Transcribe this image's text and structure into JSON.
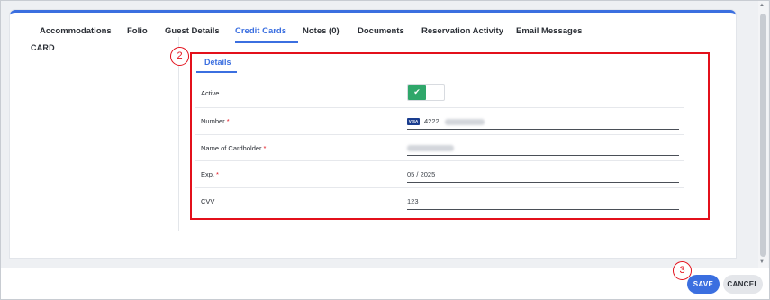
{
  "tabs": [
    {
      "label": "Accommodations"
    },
    {
      "label": "Folio"
    },
    {
      "label": "Guest Details"
    },
    {
      "label": "Credit Cards"
    },
    {
      "label": "Notes (0)"
    },
    {
      "label": "Documents"
    },
    {
      "label": "Reservation Activity"
    },
    {
      "label": "Email Messages"
    }
  ],
  "active_tab": "Credit Cards",
  "sidebar": {
    "label": "CARD"
  },
  "badges": {
    "two": "2",
    "three": "3"
  },
  "details": {
    "tab_label": "Details",
    "fields": {
      "active": {
        "label": "Active",
        "state": true
      },
      "number": {
        "label": "Number",
        "required": "*",
        "card_brand": "VISA",
        "value": "4222"
      },
      "cardholder": {
        "label": "Name of Cardholder",
        "required": "*"
      },
      "exp": {
        "label": "Exp.",
        "required": "*",
        "value": "05 / 2025"
      },
      "cvv": {
        "label": "CVV",
        "value": "123"
      }
    }
  },
  "footer": {
    "save_label": "SAVE",
    "cancel_label": "CANCEL"
  },
  "colors": {
    "accent": "#3b6fe0",
    "callout": "#e3101b",
    "toggle_on": "#2fa76a"
  },
  "icons": {
    "toggle": "check-icon",
    "scroll_up": "arrow-up-icon",
    "scroll_down": "arrow-down-icon"
  }
}
